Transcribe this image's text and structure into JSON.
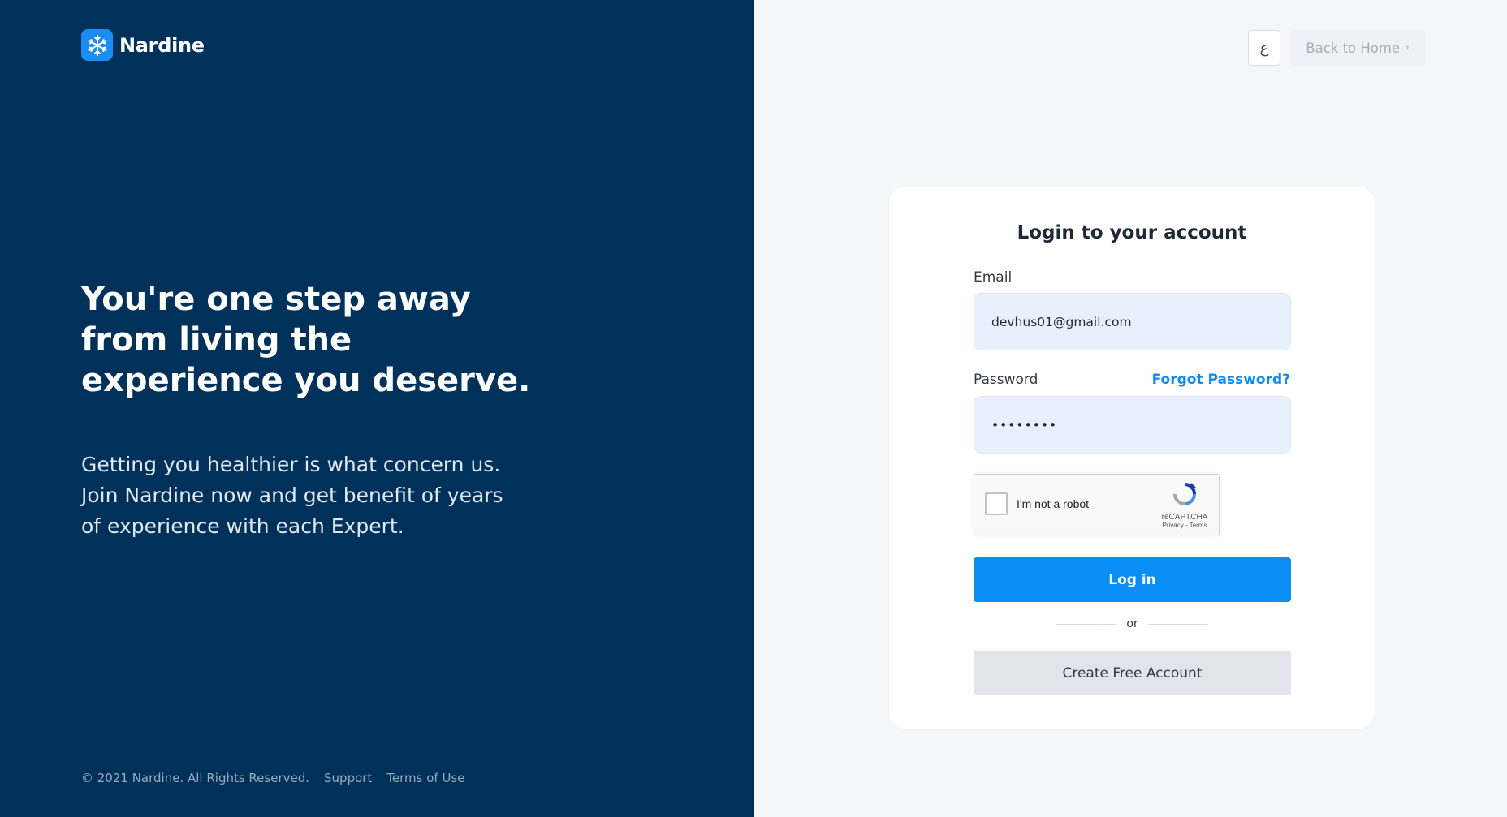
{
  "brand": {
    "name": "Nardine",
    "logo_icon": "snowflake-icon",
    "accent": "#1a8df5"
  },
  "hero": {
    "headline_lines": [
      "You're one step away",
      "from living the",
      "experience you deserve."
    ],
    "subtext_lines": [
      "Getting you healthier is what concern us.",
      "Join Nardine now and get benefit of years",
      "of experience with each Expert."
    ]
  },
  "footer": {
    "copyright": "© 2021 Nardine. All Rights Reserved.",
    "support": "Support",
    "terms": "Terms of Use"
  },
  "topbar": {
    "language_label": "ع",
    "back_home": "Back to Home",
    "back_icon": "chevron-right-icon"
  },
  "login": {
    "title": "Login to your account",
    "email_label": "Email",
    "email_value": "devhus01@gmail.com",
    "password_label": "Password",
    "password_value": "••••••••",
    "forgot": "Forgot Password?",
    "captcha_label": "I'm not a robot",
    "captcha_brand": "reCAPTCHA",
    "captcha_links": "Privacy - Terms",
    "login_button": "Log in",
    "or": "or",
    "create_button": "Create Free Account"
  },
  "colors": {
    "left_panel": "#00315a",
    "primary": "#0a8ef6",
    "link": "#0d8bf2",
    "input_bg": "#e8f0fe"
  }
}
